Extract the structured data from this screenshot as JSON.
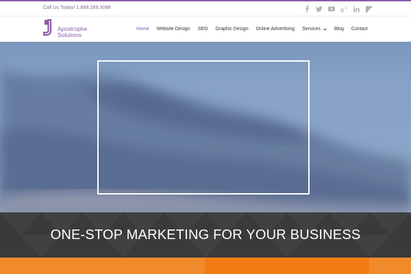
{
  "topbar": {
    "phone": "Call Us Today! 1.888.269.3098",
    "social": [
      "facebook-icon",
      "twitter-icon",
      "youtube-icon",
      "google-plus-icon",
      "linkedin-icon",
      "flipboard-icon"
    ]
  },
  "logo": {
    "line1": "Apostrophe",
    "line2": "Solutions"
  },
  "nav": {
    "items": [
      "Home",
      "Website Design",
      "SEO",
      "Graphic Design",
      "Online Advertising",
      "Services",
      "Blog",
      "Contact"
    ],
    "active": "Home"
  },
  "banner": {
    "headline": "ONE-STOP MARKETING FOR YOUR BUSINESS"
  },
  "colors": {
    "brand": "#8a5aa8",
    "banner": "#3a3a3c",
    "orange": "#f18a2b"
  }
}
